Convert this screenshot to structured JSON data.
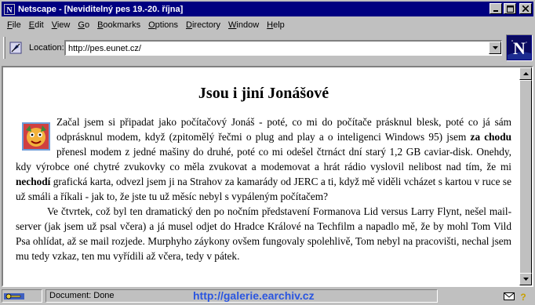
{
  "window": {
    "title": "Netscape - [Neviditelný pes 19.-20. října]"
  },
  "menu": [
    {
      "label": "File",
      "key": "F",
      "rest": "ile"
    },
    {
      "label": "Edit",
      "key": "E",
      "rest": "dit"
    },
    {
      "label": "View",
      "key": "V",
      "rest": "iew"
    },
    {
      "label": "Go",
      "key": "G",
      "rest": "o"
    },
    {
      "label": "Bookmarks",
      "key": "B",
      "rest": "ookmarks"
    },
    {
      "label": "Options",
      "key": "O",
      "rest": "ptions"
    },
    {
      "label": "Directory",
      "key": "D",
      "rest": "irectory"
    },
    {
      "label": "Window",
      "key": "W",
      "rest": "indow"
    },
    {
      "label": "Help",
      "key": "H",
      "rest": "elp"
    }
  ],
  "location": {
    "label": "Location:",
    "url": "http://pes.eunet.cz/"
  },
  "article": {
    "heading": "Jsou i jiní Jonášové",
    "p1_a": "Začal jsem si připadat jako počítačový Jonáš - poté, co mi do počítače prásknul blesk, poté co já sám odprásknul modem, když (zpitomělý řečmi o plug and play a o inteligenci Windows 95) jsem ",
    "p1_b1": "za chodu",
    "p1_c": " přenesl modem z jedné mašiny do druhé, poté co mi odešel čtrnáct dní starý 1,2 GB caviar-disk. Onehdy, kdy výrobce oné chytré zvukovky co měla zvukovat a modemovat a hrát rádio vyslovil nelibost nad tím, že mi ",
    "p1_b2": "nechodí",
    "p1_d": " grafická karta, odvezl jsem ji na Strahov za kamarády od JERC a ti, když mě viděli vcházet s kartou v ruce se už smáli a říkali - jak to, že jste tu už měsíc nebyl s vypáleným počítačem?",
    "p2": "Ve čtvrtek, což byl ten dramatický den po nočním představení Formanova Lid versus Larry Flynt, nešel mail-server (jak jsem už psal včera) a já musel odjet do Hradce Králové na Techfilm a napadlo mě, že by mohl Tom Vild Psa ohlídat, až se mail rozjede. Murphyho záykony ovšem fungovaly spolehlivě, Tom nebyl na pracovišti, nechal jsem mu tedy vzkaz, ten mu vyřídili až včera, tedy v pátek."
  },
  "status": {
    "text": "Document: Done",
    "overlay_url": "http://galerie.earchiv.cz"
  },
  "colors": {
    "titlebar": "#000080",
    "chrome": "#c0c0c0",
    "overlay_url": "#2a55e0"
  }
}
